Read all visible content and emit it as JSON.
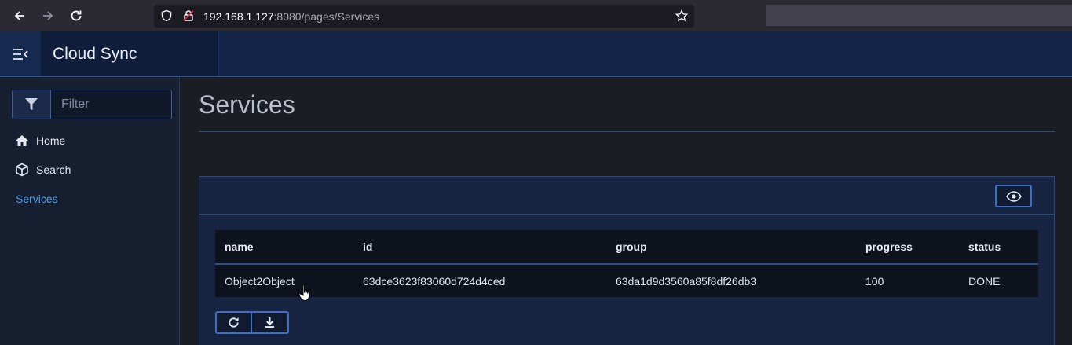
{
  "browser": {
    "url_host": "192.168.1.127",
    "url_rest": ":8080/pages/Services"
  },
  "app": {
    "title": "Cloud Sync"
  },
  "sidebar": {
    "filter_placeholder": "Filter",
    "items": [
      {
        "label": "Home",
        "icon": "home-icon"
      },
      {
        "label": "Search",
        "icon": "cube-icon"
      },
      {
        "label": "Services",
        "active": true
      }
    ]
  },
  "main": {
    "title": "Services",
    "table": {
      "columns": [
        "name",
        "id",
        "group",
        "progress",
        "status"
      ],
      "rows": [
        {
          "name": "Object2Object",
          "id": "63dce3623f83060d724d4ced",
          "group": "63da1d9d3560a85f8df26db3",
          "progress": "100",
          "status": "DONE"
        }
      ]
    }
  },
  "colors": {
    "accent": "#3d6fc2",
    "header_bg": "#152548",
    "active_link": "#4d9ae8"
  }
}
